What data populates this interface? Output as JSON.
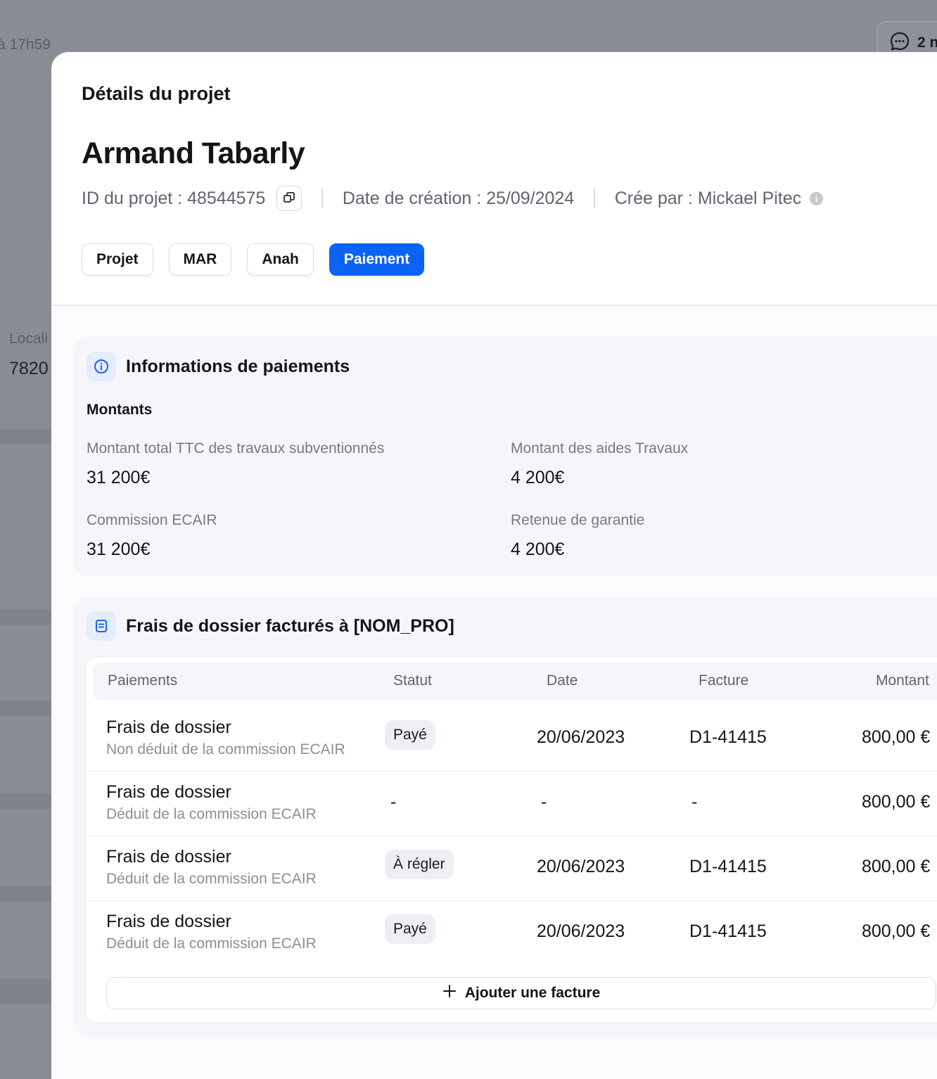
{
  "background": {
    "time_text": "à 17h59",
    "chat_count": "2 n",
    "location_label": "Locali",
    "location_value": "7820"
  },
  "modal": {
    "title": "Détails du projet",
    "client_name": "Armand Tabarly",
    "project_id": "ID du projet : 48544575",
    "creation_date": "Date de création : 25/09/2024",
    "created_by": "Crée par : Mickael Pitec",
    "tabs": [
      {
        "label": "Projet",
        "active": false
      },
      {
        "label": "MAR",
        "active": false
      },
      {
        "label": "Anah",
        "active": false
      },
      {
        "label": "Paiement",
        "active": true
      }
    ]
  },
  "payment_info": {
    "title": "Informations de paiements",
    "section": "Montants",
    "fields": [
      {
        "label": "Montant total TTC des travaux subventionnés",
        "value": "31 200€"
      },
      {
        "label": "Montant des aides Travaux",
        "value": "4 200€"
      },
      {
        "label": "Commission ECAIR",
        "value": "31 200€"
      },
      {
        "label": "Retenue de garantie",
        "value": "4 200€"
      }
    ]
  },
  "fees": {
    "title": "Frais de dossier facturés à [NOM_PRO]",
    "columns": [
      "Paiements",
      "Statut",
      "Date",
      "Facture",
      "Montant"
    ],
    "rows": [
      {
        "label": "Frais de dossier",
        "sub": "Non déduit de la commission ECAIR",
        "status": "Payé",
        "date": "20/06/2023",
        "invoice": "D1-41415",
        "amount": "800,00 €"
      },
      {
        "label": "Frais de dossier",
        "sub": "Déduit de la commission ECAIR",
        "status": "-",
        "date": "-",
        "invoice": "-",
        "amount": "800,00 €"
      },
      {
        "label": "Frais de dossier",
        "sub": "Déduit de la commission ECAIR",
        "status": "À régler",
        "date": "20/06/2023",
        "invoice": "D1-41415",
        "amount": "800,00 €"
      },
      {
        "label": "Frais de dossier",
        "sub": "Déduit de la commission ECAIR",
        "status": "Payé",
        "date": "20/06/2023",
        "invoice": "D1-41415",
        "amount": "800,00 €"
      }
    ],
    "add_label": "Ajouter une facture"
  },
  "colors": {
    "accent": "#0b63f6",
    "overlay": "#8a8d96",
    "card": "#f6f6fa"
  }
}
